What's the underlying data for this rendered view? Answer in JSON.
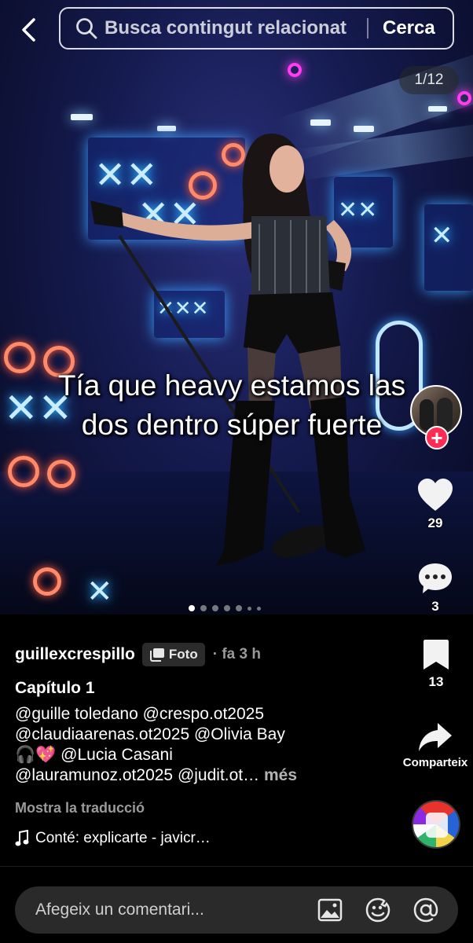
{
  "search": {
    "placeholder": "Busca contingut relacionat",
    "button_label": "Cerca"
  },
  "carousel": {
    "counter": "1/12",
    "caption_line1": "Tía que heavy estamos las",
    "caption_line2": "dos dentro súper fuerte",
    "current_index": 1,
    "total": 12
  },
  "actions": {
    "likes": "29",
    "comments": "3",
    "bookmarks": "13",
    "share_label": "Comparteix"
  },
  "post": {
    "username": "guillexcrespillo",
    "type_badge": "Foto",
    "time_ago": "· fa 3 h",
    "title": "Capítulo 1",
    "description_line1": "@guille toledano @crespo.ot2025",
    "description_line2": "@claudiaarenas.ot2025 @Olivia Bay",
    "description_line3_emoji": "🎧💖",
    "description_line3_text": "@Lucia Casani",
    "description_line4": "@lauramunoz.ot2025 @judit.ot…",
    "more_label": "més",
    "translate_label": "Mostra la traducció",
    "music_label": "Conté: explicarte - javicr…"
  },
  "comment_bar": {
    "placeholder": "Afegeix un comentari..."
  },
  "icons": {
    "back": "chevron-left-icon",
    "search": "search-icon",
    "heart": "heart-icon",
    "comment": "comment-icon",
    "bookmark": "bookmark-icon",
    "share": "share-icon",
    "music": "music-note-icon",
    "image": "image-icon",
    "emoji": "emoji-icon",
    "mention": "at-icon"
  },
  "colors": {
    "follow_plus": "#fe2c55",
    "background": "#000000"
  }
}
